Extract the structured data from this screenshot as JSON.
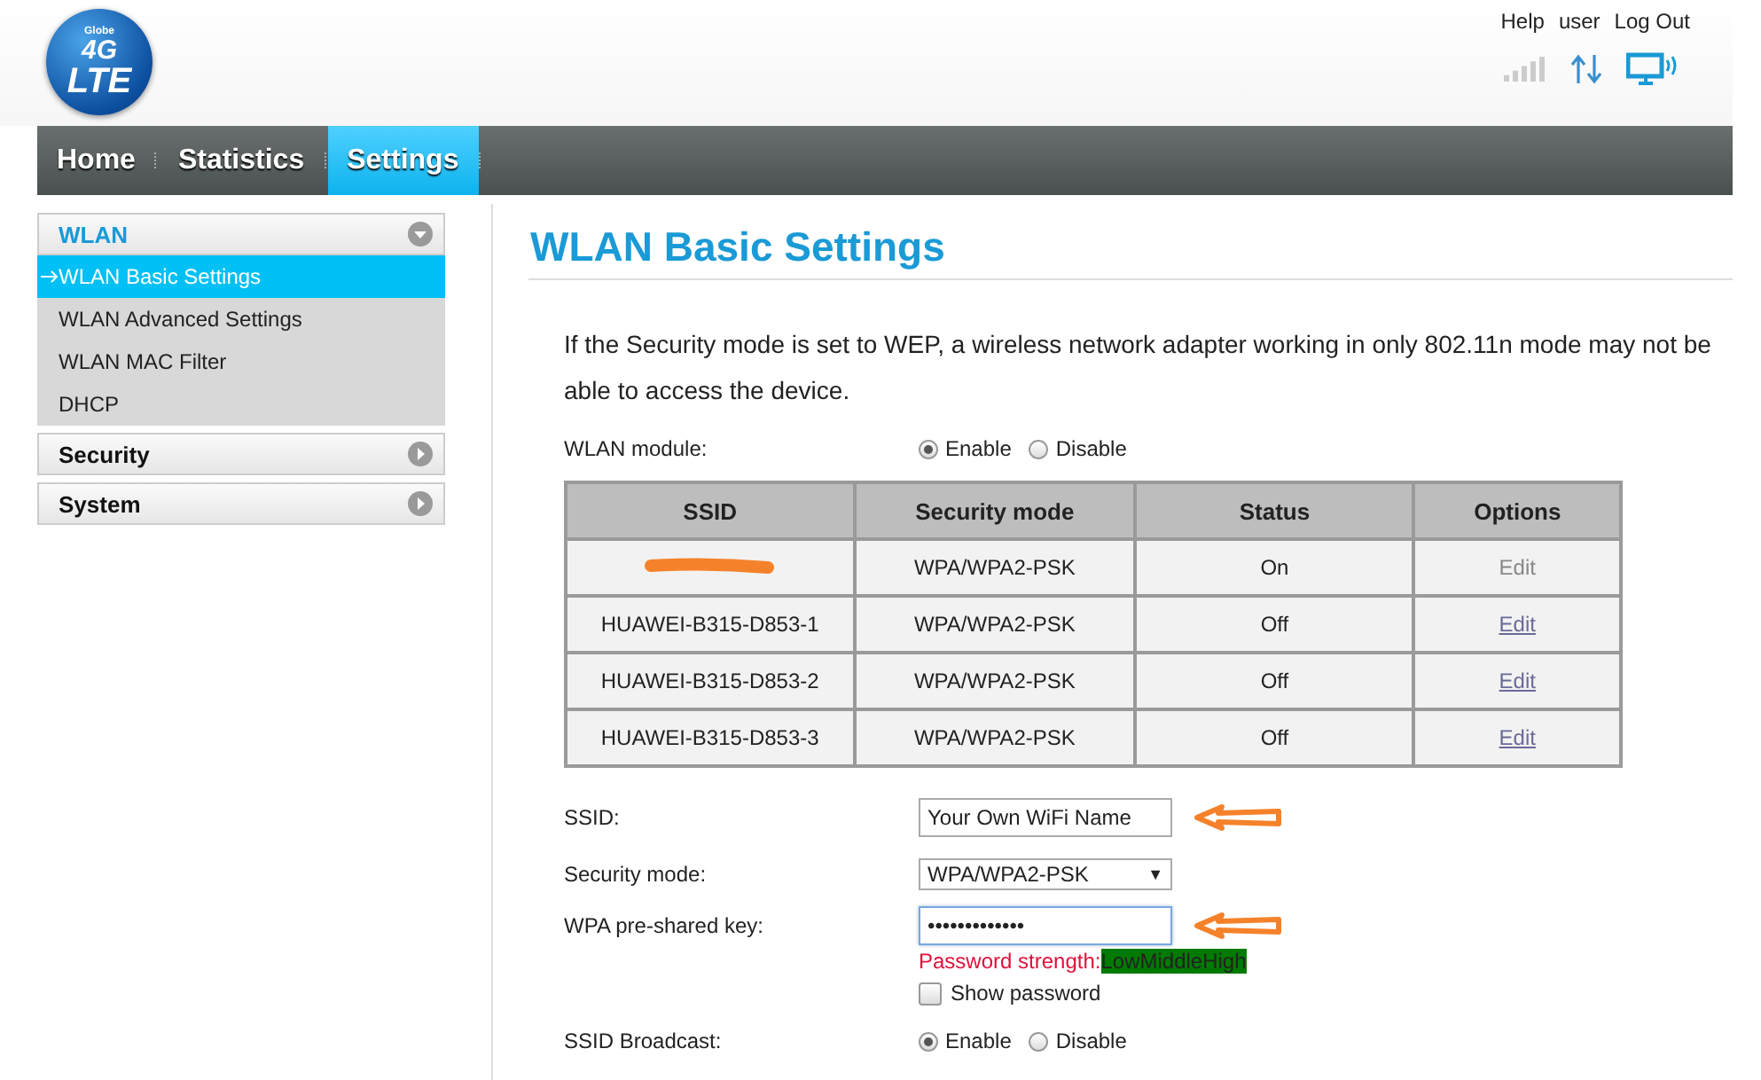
{
  "logo": {
    "brand": "Globe",
    "line1": "4G",
    "line2": "LTE"
  },
  "header": {
    "links": [
      {
        "label": "Help"
      },
      {
        "label": "user"
      },
      {
        "label": "Log Out"
      }
    ]
  },
  "nav": {
    "tabs": [
      {
        "label": "Home",
        "selected": false
      },
      {
        "label": "Statistics",
        "selected": false
      },
      {
        "label": "Settings",
        "selected": true
      }
    ]
  },
  "sidebar": {
    "groups": [
      {
        "label": "WLAN",
        "expanded": true,
        "items": [
          {
            "label": "WLAN Basic Settings",
            "selected": true
          },
          {
            "label": "WLAN Advanced Settings",
            "selected": false
          },
          {
            "label": "WLAN MAC Filter",
            "selected": false
          },
          {
            "label": "DHCP",
            "selected": false
          }
        ]
      },
      {
        "label": "Security",
        "expanded": false
      },
      {
        "label": "System",
        "expanded": false
      }
    ]
  },
  "page": {
    "title": "WLAN Basic Settings",
    "note": "If the Security mode is set to WEP, a wireless network adapter working in only 802.11n mode may not be able to access the device.",
    "wlan_module": {
      "label": "WLAN module:",
      "options": [
        {
          "label": "Enable",
          "selected": true
        },
        {
          "label": "Disable",
          "selected": false
        }
      ]
    },
    "table": {
      "columns": [
        "SSID",
        "Security mode",
        "Status",
        "Options"
      ],
      "rows": [
        {
          "redacted": true,
          "security": "WPA/WPA2-PSK",
          "status": "On",
          "option": {
            "label": "Edit",
            "disabled": true
          }
        },
        {
          "redacted": false,
          "ssid": "HUAWEI-B315-D853-1",
          "security": "WPA/WPA2-PSK",
          "status": "Off",
          "option": {
            "label": "Edit",
            "disabled": false
          }
        },
        {
          "redacted": false,
          "ssid": "HUAWEI-B315-D853-2",
          "security": "WPA/WPA2-PSK",
          "status": "Off",
          "option": {
            "label": "Edit",
            "disabled": false
          }
        },
        {
          "redacted": false,
          "ssid": "HUAWEI-B315-D853-3",
          "security": "WPA/WPA2-PSK",
          "status": "Off",
          "option": {
            "label": "Edit",
            "disabled": false
          }
        }
      ]
    },
    "form": {
      "ssid": {
        "label": "SSID:",
        "value": "Your Own WiFi Name"
      },
      "security_mode": {
        "label": "Security mode:",
        "value": "WPA/WPA2-PSK",
        "caret": "▼"
      },
      "key": {
        "label": "WPA pre-shared key:",
        "value": "•••••••••••••",
        "focused": true
      },
      "strength": {
        "label": "Password strength:",
        "levels": [
          "Low",
          "Middle",
          "High"
        ]
      },
      "show_password": {
        "label": "Show password",
        "checked": false
      },
      "ssid_broadcast": {
        "label": "SSID Broadcast:",
        "options": [
          {
            "label": "Enable",
            "selected": true
          },
          {
            "label": "Disable",
            "selected": false
          }
        ]
      }
    }
  }
}
